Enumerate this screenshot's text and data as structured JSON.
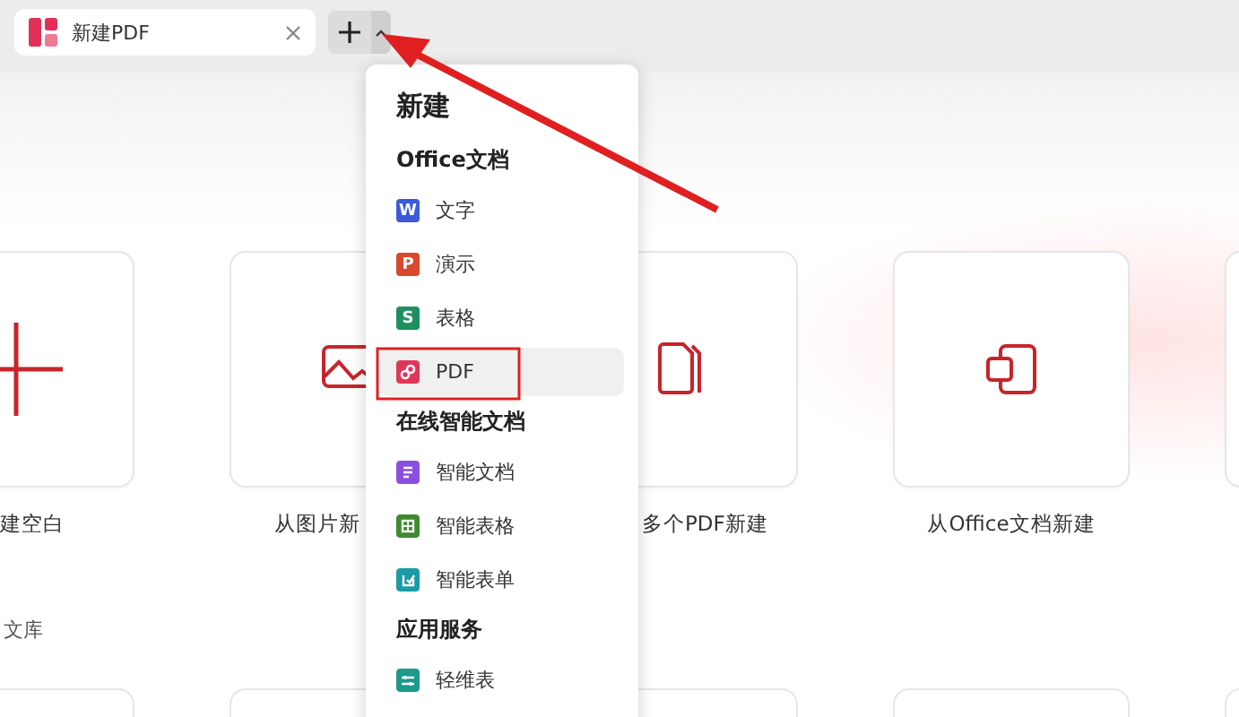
{
  "tab": {
    "title": "新建PDF"
  },
  "cards": [
    {
      "label": "建空白"
    },
    {
      "label": "从图片新"
    },
    {
      "label": "多个PDF新建"
    },
    {
      "label": "从Office文档新建"
    }
  ],
  "section_label": "文库",
  "menu": {
    "title": "新建",
    "groups": [
      {
        "heading": "Office文档",
        "items": [
          {
            "label": "文字",
            "icon_letter": "W",
            "color": "#3b5bdb",
            "selected": false
          },
          {
            "label": "演示",
            "icon_letter": "P",
            "color": "#d9482b",
            "selected": false
          },
          {
            "label": "表格",
            "icon_letter": "S",
            "color": "#1f8f5f",
            "selected": false
          },
          {
            "label": "PDF",
            "kind": "pdf",
            "color": "#e0365a",
            "selected": true
          }
        ]
      },
      {
        "heading": "在线智能文档",
        "items": [
          {
            "label": "智能文档",
            "kind": "doc",
            "color": "#8a4fe0",
            "selected": false
          },
          {
            "label": "智能表格",
            "kind": "sheet",
            "color": "#3d8a2f",
            "selected": false
          },
          {
            "label": "智能表单",
            "kind": "form",
            "color": "#1c9aa6",
            "selected": false
          }
        ]
      },
      {
        "heading": "应用服务",
        "items": [
          {
            "label": "轻维表",
            "kind": "table",
            "color": "#1c9a8a",
            "selected": false
          }
        ]
      }
    ]
  }
}
